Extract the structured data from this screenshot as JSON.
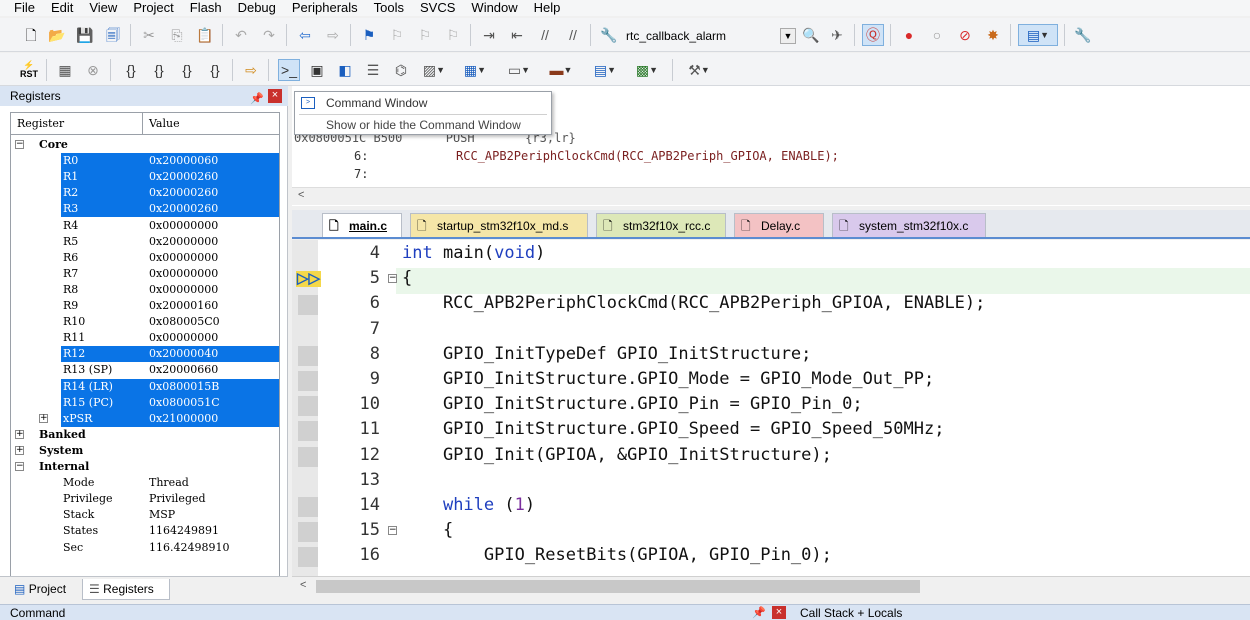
{
  "menu": [
    "File",
    "Edit",
    "View",
    "Project",
    "Flash",
    "Debug",
    "Peripherals",
    "Tools",
    "SVCS",
    "Window",
    "Help"
  ],
  "toolbar": {
    "target": "rtc_callback_alarm",
    "rst_label": "RST"
  },
  "registers_panel": {
    "title": "Registers",
    "col_register": "Register",
    "col_value": "Value",
    "groups": {
      "core": "Core",
      "banked": "Banked",
      "system": "System",
      "internal": "Internal"
    },
    "core": [
      {
        "name": "R0",
        "value": "0x20000060",
        "selected": true
      },
      {
        "name": "R1",
        "value": "0x20000260",
        "selected": true
      },
      {
        "name": "R2",
        "value": "0x20000260",
        "selected": true
      },
      {
        "name": "R3",
        "value": "0x20000260",
        "selected": true
      },
      {
        "name": "R4",
        "value": "0x00000000",
        "selected": false
      },
      {
        "name": "R5",
        "value": "0x20000000",
        "selected": false
      },
      {
        "name": "R6",
        "value": "0x00000000",
        "selected": false
      },
      {
        "name": "R7",
        "value": "0x00000000",
        "selected": false
      },
      {
        "name": "R8",
        "value": "0x00000000",
        "selected": false
      },
      {
        "name": "R9",
        "value": "0x20000160",
        "selected": false
      },
      {
        "name": "R10",
        "value": "0x080005C0",
        "selected": false
      },
      {
        "name": "R11",
        "value": "0x00000000",
        "selected": false
      },
      {
        "name": "R12",
        "value": "0x20000040",
        "selected": true
      },
      {
        "name": "R13 (SP)",
        "value": "0x20000660",
        "selected": false
      },
      {
        "name": "R14 (LR)",
        "value": "0x0800015B",
        "selected": true
      },
      {
        "name": "R15 (PC)",
        "value": "0x0800051C",
        "selected": true
      },
      {
        "name": "xPSR",
        "value": "0x21000000",
        "selected": true
      }
    ],
    "internal": [
      {
        "name": "Mode",
        "value": "Thread"
      },
      {
        "name": "Privilege",
        "value": "Privileged"
      },
      {
        "name": "Stack",
        "value": "MSP"
      },
      {
        "name": "States",
        "value": "1164249891"
      },
      {
        "name": "Sec",
        "value": "116.42498910"
      }
    ],
    "tabs": [
      "Project",
      "Registers"
    ]
  },
  "tooltip": {
    "title": "Command Window",
    "description": "Show or hide the Command Window"
  },
  "disassembly": {
    "partial_instr": "{r3,lr}",
    "partial_addr": "0x0800051C B500      PUSH",
    "lines": [
      {
        "num": "6:",
        "code": "RCC_APB2PeriphClockCmd(RCC_APB2Periph_GPIOA, ENABLE);"
      },
      {
        "num": "7:",
        "code": ""
      }
    ]
  },
  "editor_tabs": [
    {
      "label": "main.c",
      "active": true,
      "color": "#f3f4f6"
    },
    {
      "label": "startup_stm32f10x_md.s",
      "active": false,
      "color": "#f5e6a8"
    },
    {
      "label": "stm32f10x_rcc.c",
      "active": false,
      "color": "#dde8b8"
    },
    {
      "label": "Delay.c",
      "active": false,
      "color": "#f3c2c4"
    },
    {
      "label": "system_stm32f10x.c",
      "active": false,
      "color": "#d9c9ec"
    }
  ],
  "code_lines": [
    {
      "num": "4",
      "text": "int main(void)"
    },
    {
      "num": "5",
      "text": "{"
    },
    {
      "num": "6",
      "text": "    RCC_APB2PeriphClockCmd(RCC_APB2Periph_GPIOA, ENABLE);"
    },
    {
      "num": "7",
      "text": ""
    },
    {
      "num": "8",
      "text": "    GPIO_InitTypeDef GPIO_InitStructure;"
    },
    {
      "num": "9",
      "text": "    GPIO_InitStructure.GPIO_Mode = GPIO_Mode_Out_PP;"
    },
    {
      "num": "10",
      "text": "    GPIO_InitStructure.GPIO_Pin = GPIO_Pin_0;"
    },
    {
      "num": "11",
      "text": "    GPIO_InitStructure.GPIO_Speed = GPIO_Speed_50MHz;"
    },
    {
      "num": "12",
      "text": "    GPIO_Init(GPIOA, &GPIO_InitStructure);"
    },
    {
      "num": "13",
      "text": ""
    },
    {
      "num": "14",
      "text": "    while (1)"
    },
    {
      "num": "15",
      "text": "    {"
    },
    {
      "num": "16",
      "text": "        GPIO_ResetBits(GPIOA, GPIO_Pin_0);"
    }
  ],
  "bottom": {
    "command": "Command",
    "call_stack": "Call Stack + Locals"
  },
  "colors": {
    "selection": "#0a74e6",
    "panel_title": "#d9e4f3",
    "current_line": "#eaf7ea",
    "keyword": "#1f3fbf"
  }
}
